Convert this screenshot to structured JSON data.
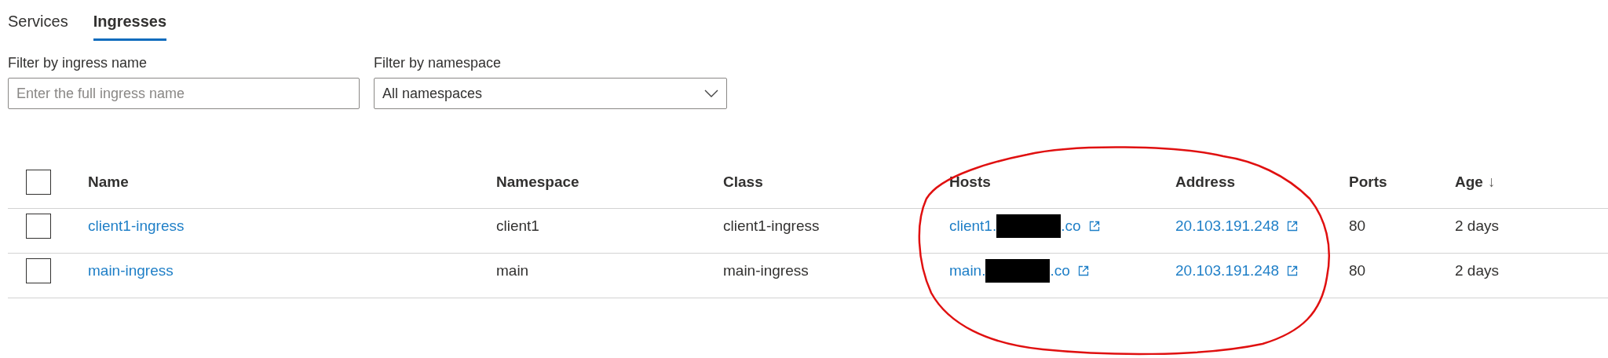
{
  "tabs": [
    {
      "label": "Services",
      "selected": false
    },
    {
      "label": "Ingresses",
      "selected": true
    }
  ],
  "filters": [
    {
      "kind": "text",
      "label": "Filter by ingress name",
      "placeholder": "Enter the full ingress name"
    },
    {
      "kind": "dropdown",
      "label": "Filter by namespace",
      "value": "All namespaces"
    }
  ],
  "table": {
    "select_all_checked": false,
    "columns": [
      {
        "label": "Name"
      },
      {
        "label": "Namespace"
      },
      {
        "label": "Class"
      },
      {
        "label": "Hosts"
      },
      {
        "label": "Address"
      },
      {
        "label": "Ports"
      },
      {
        "label": "Age",
        "sort_indicator": "↓"
      }
    ],
    "rows": [
      {
        "checked": false,
        "name": "client1-ingress",
        "namespace": "client1",
        "class": "client1-ingress",
        "host_prefix": "client1.",
        "host_redacted": true,
        "host_suffix": ".co",
        "address": "20.103.191.248",
        "ports": "80",
        "age": "2 days"
      },
      {
        "checked": false,
        "name": "main-ingress",
        "namespace": "main",
        "class": "main-ingress",
        "host_prefix": "main.",
        "host_redacted": true,
        "host_suffix": ".co",
        "address": "20.103.191.248",
        "ports": "80",
        "age": "2 days"
      }
    ]
  },
  "annotation": {
    "kind": "circle"
  }
}
